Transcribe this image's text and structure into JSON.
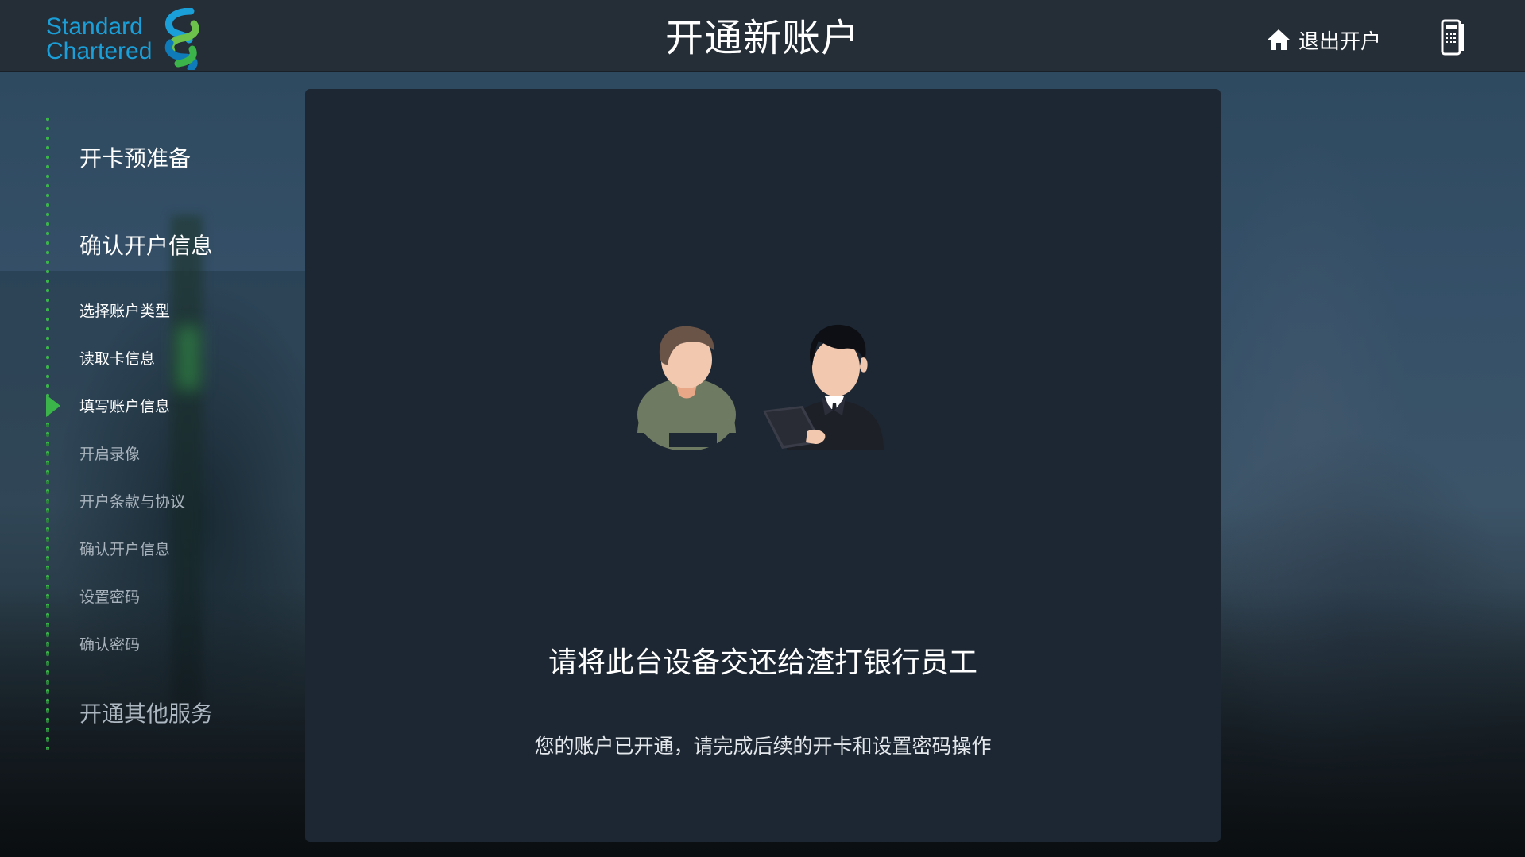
{
  "brand": {
    "logo_line1": "Standard",
    "logo_line2": "Chartered",
    "accent_blue": "#1a9fd8",
    "accent_green": "#3bb54a"
  },
  "header": {
    "title": "开通新账户",
    "exit_label": "退出开户",
    "exit_icon": "home-icon",
    "device_icon": "card-reader-icon"
  },
  "steps": {
    "section1": "开卡预准备",
    "section2": "确认开户信息",
    "items": [
      {
        "label": "选择账户类型",
        "state": "done"
      },
      {
        "label": "读取卡信息",
        "state": "done"
      },
      {
        "label": "填写账户信息",
        "state": "active"
      },
      {
        "label": "开启录像",
        "state": "pending"
      },
      {
        "label": "开户条款与协议",
        "state": "pending"
      },
      {
        "label": "确认开户信息",
        "state": "pending"
      },
      {
        "label": "设置密码",
        "state": "pending"
      },
      {
        "label": "确认密码",
        "state": "pending"
      }
    ],
    "section3": "开通其他服务"
  },
  "main": {
    "illustration": "customer-and-staff-illustration",
    "message": "请将此台设备交还给渣打银行员工",
    "submessage": "您的账户已开通，请完成后续的开卡和设置密码操作"
  }
}
